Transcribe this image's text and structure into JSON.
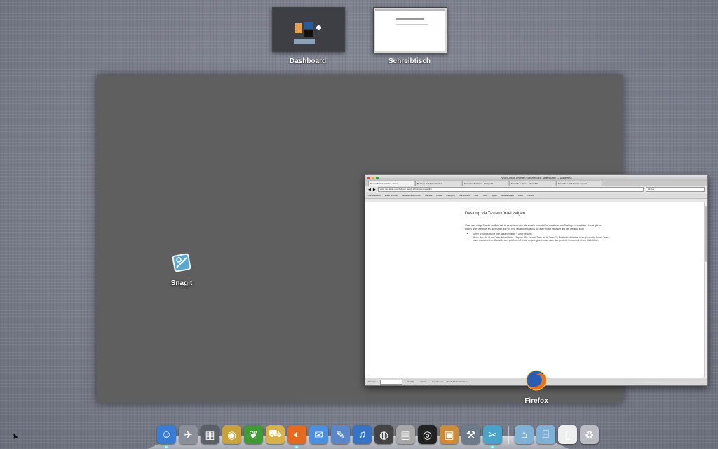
{
  "spaces": [
    {
      "label": "Dashboard"
    },
    {
      "label": "Schreibtisch"
    }
  ],
  "apps": {
    "snagit": {
      "label": "Snagit"
    },
    "firefox": {
      "label": "Firefox"
    }
  },
  "firefox_window": {
    "title": "Neuen Artikel erstellen ‹ Beamen und Tastenkürzel — WordPress",
    "tabs": [
      "Neuen Artikel erstellen ‹ Word",
      "Beamen und Tastenkürzel",
      "Tastenkombination – Wikipedia",
      "Mac OS X Tipps – Mausklick",
      "Mac OS X 10.6 Snow Leopard"
    ],
    "url": "www.das-tastenkuerzelbuch.de/wp-admin/post-new.php",
    "search_text": "Firefox",
    "bookmarks": [
      "Meistbesucht",
      "Erste Schritte",
      "Aktuelle Nachrichten",
      "Dienste",
      "Fotos",
      "Shopping",
      "Nachrichten",
      "Mac",
      "Tools",
      "Apple",
      "Google Maps",
      "Flickr",
      "Yahoo!"
    ],
    "heading": "Desktop via Tastenkürzel zeigen",
    "paragraph": "Wenn man einige Fenster geöffnet hat, ist es mühsam sich alle einzeln zu schließen, um etwas vom Desktop auszuwählen. Darum gibt es sowohl unter Windows als auch unter Mac OS eine Tastenkombination, die alle Fenster minimiert und den Desktop zeigt:",
    "bullets": [
      "Unter Windows drückt man dafür Windows + D für Desktop.",
      "Unter Mac OS ist das Tastenkürzel Apfel + Expose. Die Exposé-Taste ist die Taste F3. Zusätzlich drückbar, bewegt man die Cursor-Taste nach rechts zu einer Übersicht aller geöffneten Fenster angezeigt und muss dann das gewählte Fenster mit einem Klick öffnen."
    ],
    "status_items": [
      "Suchen:",
      "Abwärts",
      "Aufwärts",
      "Hervorheben",
      "Groß-/Kleinschreibung"
    ]
  },
  "dock": {
    "items": [
      {
        "name": "finder",
        "glyph": "☺",
        "color": "#3a7bd5"
      },
      {
        "name": "launchpad",
        "glyph": "✈",
        "color": "#8a8f99"
      },
      {
        "name": "mission-control",
        "glyph": "▦",
        "color": "#5a5f68"
      },
      {
        "name": "photo-booth",
        "glyph": "◉",
        "color": "#c9a23b"
      },
      {
        "name": "leaf",
        "glyph": "❦",
        "color": "#3f9c35"
      },
      {
        "name": "transmit",
        "glyph": "⛟",
        "color": "#d9b04a"
      },
      {
        "name": "firefox",
        "glyph": "◐",
        "color": "#e36a1e"
      },
      {
        "name": "ichat",
        "glyph": "✉",
        "color": "#4a8fe0"
      },
      {
        "name": "preview",
        "glyph": "✎",
        "color": "#5b86c7"
      },
      {
        "name": "itunes",
        "glyph": "♫",
        "color": "#3573c4"
      },
      {
        "name": "dashboard",
        "glyph": "◍",
        "color": "#444"
      },
      {
        "name": "calculator",
        "glyph": "▤",
        "color": "#a7a7a7"
      },
      {
        "name": "aperture",
        "glyph": "◎",
        "color": "#222"
      },
      {
        "name": "package",
        "glyph": "▣",
        "color": "#c98c3a"
      },
      {
        "name": "system-tool",
        "glyph": "⚒",
        "color": "#6c7a8a"
      },
      {
        "name": "snagit",
        "glyph": "✂",
        "color": "#4aa3c9"
      }
    ],
    "folders": [
      {
        "name": "applications-folder",
        "glyph": "⌂",
        "color": "#7fb0d6"
      },
      {
        "name": "documents-folder",
        "glyph": "⌸",
        "color": "#7fb0d6"
      },
      {
        "name": "file",
        "glyph": "▯",
        "color": "#eee"
      },
      {
        "name": "trash",
        "glyph": "♻",
        "color": "#b9bcc2"
      }
    ]
  }
}
